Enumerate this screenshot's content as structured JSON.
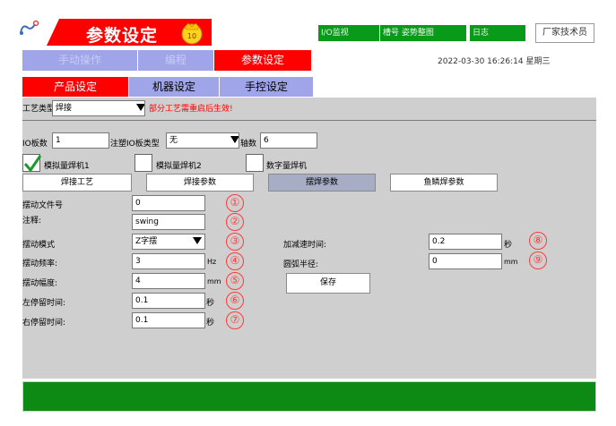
{
  "header": {
    "title": "参数设定",
    "badge": "10",
    "buttons": {
      "io_monitor": "I/O监视",
      "pose_graph": "槽号 姿势整图",
      "log": "日志",
      "vendor": "厂家技术员"
    }
  },
  "nav": {
    "manual": "手动操作",
    "program": "编程",
    "params": "参数设定"
  },
  "datetime": "2022-03-30  16:26:14  星期三",
  "tabs": {
    "product": "产品设定",
    "machine": "机器设定",
    "pendant": "手控设定"
  },
  "process": {
    "label": "工艺类型",
    "value": "焊接",
    "warning": "部分工艺需重启后生效!"
  },
  "io": {
    "board_count_label": "IO板数",
    "board_count": "1",
    "board_type_label": "注塑IO板类型",
    "board_type": "无",
    "axes_label": "轴数",
    "axes": "6"
  },
  "checkboxes": [
    {
      "label": "模拟量焊机1",
      "checked": true
    },
    {
      "label": "模拟量焊机2",
      "checked": false
    },
    {
      "label": "数字量焊机",
      "checked": false
    }
  ],
  "subtabs": {
    "process": "焊接工艺",
    "weld": "焊接参数",
    "swing": "摆焊参数",
    "fishscale": "鱼鳞焊参数"
  },
  "swing": {
    "file_label": "摆动文件号",
    "file": "0",
    "note_label": "注释:",
    "note": "swing",
    "mode_label": "摆动模式",
    "mode": "Z字摆",
    "freq_label": "摆动频率:",
    "freq": "3",
    "freq_unit": "Hz",
    "amp_label": "摆动幅度:",
    "amp": "4",
    "amp_unit": "mm",
    "left_dwell_label": "左停留时间:",
    "left_dwell": "0.1",
    "left_dwell_unit": "秒",
    "right_dwell_label": "右停留时间:",
    "right_dwell": "0.1",
    "right_dwell_unit": "秒",
    "accel_label": "加减速时间:",
    "accel": "0.2",
    "accel_unit": "秒",
    "radius_label": "圆弧半径:",
    "radius": "0",
    "radius_unit": "mm",
    "save": "保存"
  },
  "markers": [
    "①",
    "②",
    "③",
    "④",
    "⑤",
    "⑥",
    "⑦",
    "⑧",
    "⑨"
  ],
  "colors": {
    "accent_red": "#ff0000",
    "nav_gray": "#a0a4e8",
    "green": "#0a9a19",
    "panel": "#cfcfcf"
  }
}
